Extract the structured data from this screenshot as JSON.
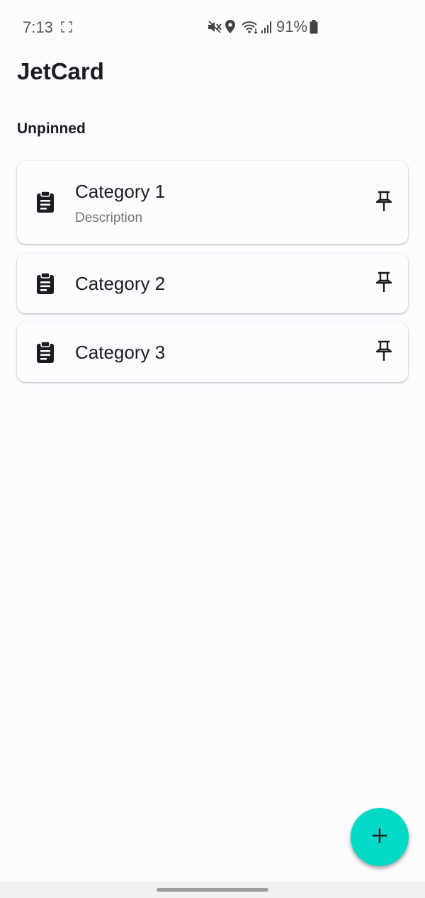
{
  "status_bar": {
    "time": "7:13",
    "battery": "91%",
    "icons": [
      "screenshot-icon",
      "mute-vibrate-icon",
      "location-icon",
      "wifi-icon",
      "signal-icon",
      "battery-icon"
    ]
  },
  "app": {
    "title": "JetCard"
  },
  "section": {
    "title": "Unpinned"
  },
  "cards": [
    {
      "title": "Category 1",
      "description": "Description",
      "icon": "clipboard-icon",
      "action_icon": "pin-icon"
    },
    {
      "title": "Category 2",
      "icon": "clipboard-icon",
      "action_icon": "pin-icon"
    },
    {
      "title": "Category 3",
      "icon": "clipboard-icon",
      "action_icon": "pin-icon"
    }
  ],
  "fab": {
    "icon": "plus-icon",
    "color": "#03dac5"
  },
  "colors": {
    "background": "#fdfbfe",
    "card": "#fefbff",
    "text": "#1c1b1f",
    "secondary_text": "#757575",
    "accent": "#03dac5"
  }
}
